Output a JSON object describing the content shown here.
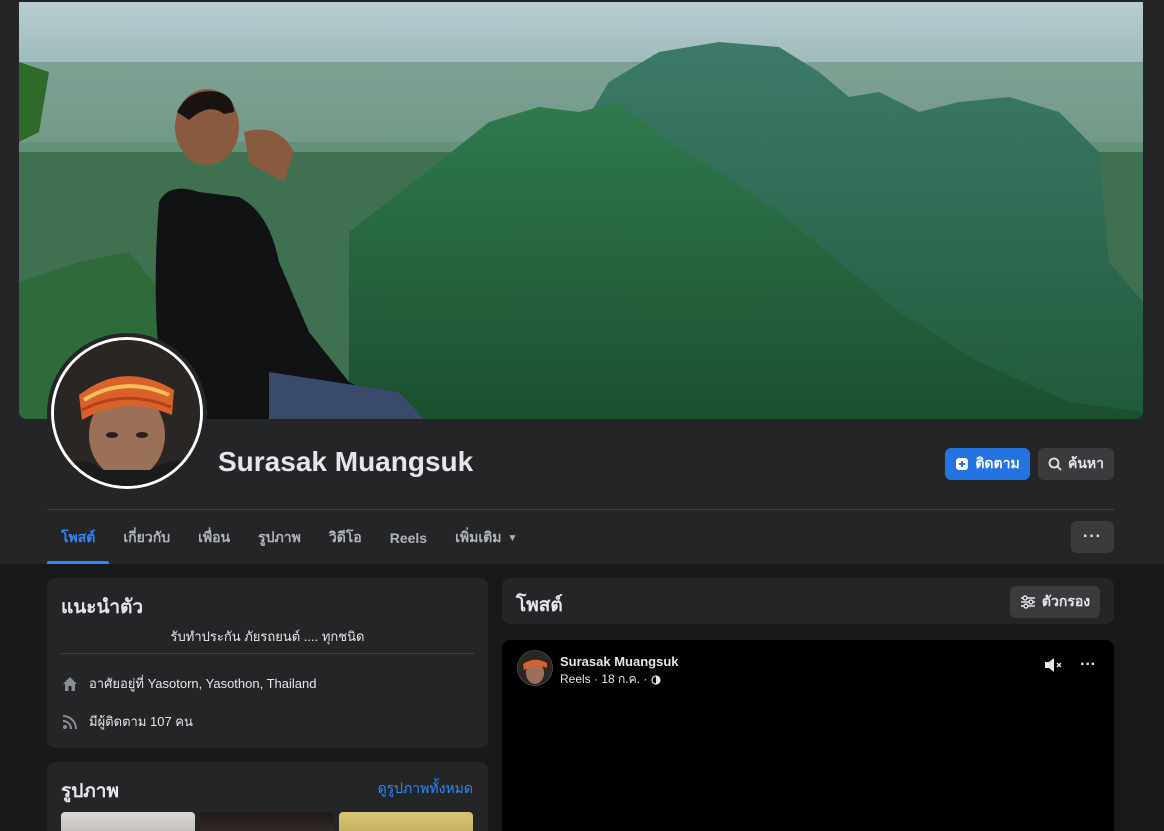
{
  "profile": {
    "name": "Surasak Muangsuk",
    "follow_label": "ติดตาม",
    "search_label": "ค้นหา",
    "more_label": "···"
  },
  "tabs": [
    {
      "label": "โพสต์",
      "active": true
    },
    {
      "label": "เกี่ยวกับ"
    },
    {
      "label": "เพื่อน"
    },
    {
      "label": "รูปภาพ"
    },
    {
      "label": "วิดีโอ"
    },
    {
      "label": "Reels"
    },
    {
      "label": "เพิ่มเติม"
    }
  ],
  "intro": {
    "title": "แนะนำตัว",
    "bio": "รับทำประกัน ภัยรถยนต์ .... ทุกชนิด",
    "lives_in": "อาศัยอยู่ที่ Yasotorn, Yasothon, Thailand",
    "followers": "มีผู้ติดตาม 107 คน"
  },
  "photos": {
    "title": "รูปภาพ",
    "see_all": "ดูรูปภาพทั้งหมด"
  },
  "posts": {
    "title": "โพสต์",
    "filter_label": "ตัวกรอง"
  },
  "post": {
    "author": "Surasak Muangsuk",
    "meta": "Reels · 18 ก.ค. ·"
  },
  "colors": {
    "accent": "#2374e1",
    "link": "#2d88ff",
    "card_bg": "#242526",
    "page_bg": "#18191a"
  }
}
